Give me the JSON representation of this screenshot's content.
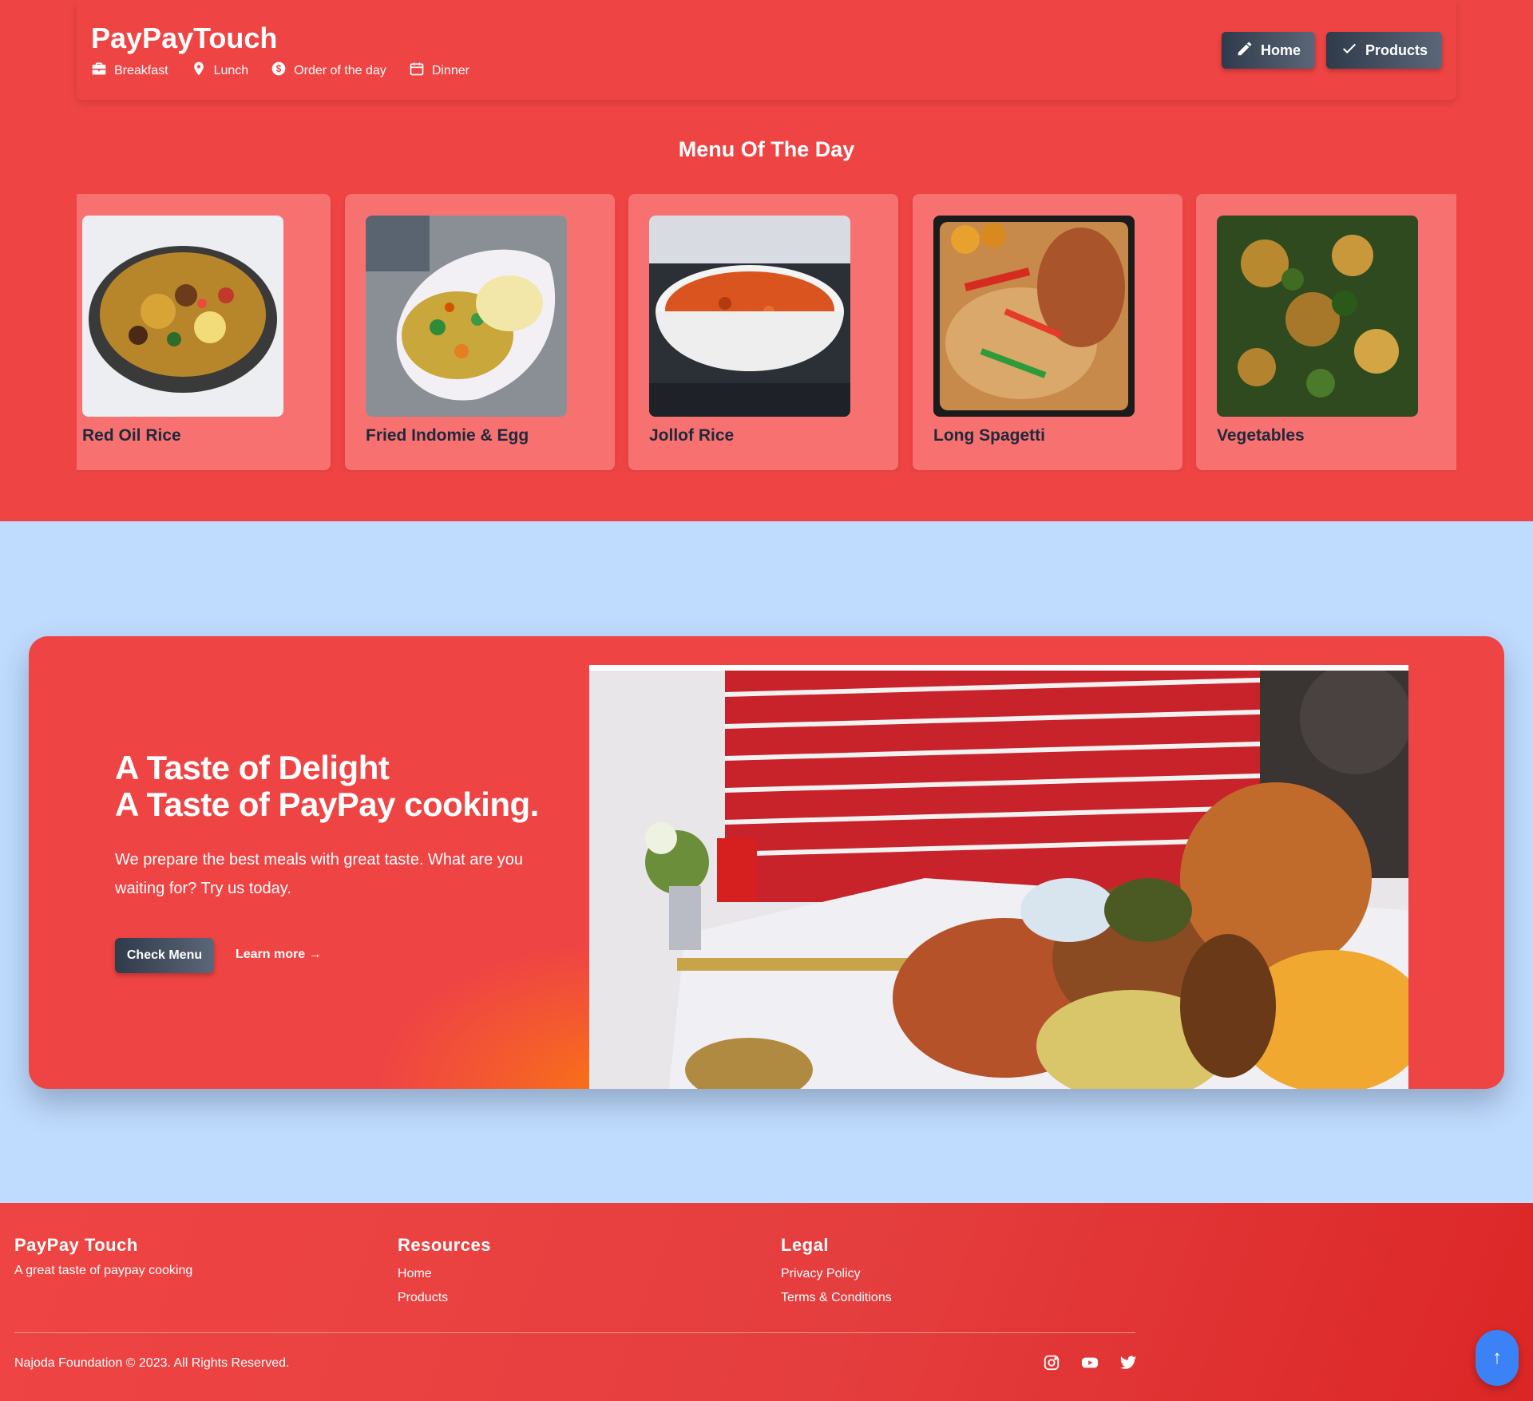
{
  "header": {
    "brand": "PayPayTouch",
    "subnav": [
      {
        "label": "Breakfast",
        "icon": "briefcase-icon"
      },
      {
        "label": "Lunch",
        "icon": "location-pin-icon"
      },
      {
        "label": "Order of the day",
        "icon": "dollar-icon"
      },
      {
        "label": "Dinner",
        "icon": "calendar-icon"
      }
    ],
    "buttons": [
      {
        "label": "Home",
        "icon": "pencil-icon"
      },
      {
        "label": "Products",
        "icon": "check-icon"
      }
    ]
  },
  "menu": {
    "title": "Menu Of The Day",
    "items": [
      {
        "name": "Red Oil Rice"
      },
      {
        "name": "Fried Indomie & Egg"
      },
      {
        "name": "Jollof Rice"
      },
      {
        "name": "Long Spagetti"
      },
      {
        "name": "Vegetables"
      }
    ]
  },
  "hero": {
    "line1": "A Taste of Delight",
    "line2": "A Taste of PayPay cooking.",
    "text": "We prepare the best meals with great taste. What are you waiting for? Try us today.",
    "cta": "Check Menu",
    "link": "Learn more →"
  },
  "footer": {
    "brand": "PayPay Touch",
    "tagline": "A great taste of paypay cooking",
    "resources": {
      "title": "Resources",
      "links": [
        "Home",
        "Products"
      ]
    },
    "legal": {
      "title": "Legal",
      "links": [
        "Privacy Policy",
        "Terms & Conditions"
      ]
    },
    "copyright": "Najoda Foundation © 2023. All Rights Reserved.",
    "social": [
      "instagram-icon",
      "youtube-icon",
      "twitter-icon"
    ],
    "back_to_top": "↑"
  },
  "colors": {
    "primary_red": "#ef4444",
    "card_red": "#f87171",
    "page_blue": "#bfdbfe",
    "button_dark": "#2f3a4a",
    "top_button_blue": "#3b82f6"
  }
}
